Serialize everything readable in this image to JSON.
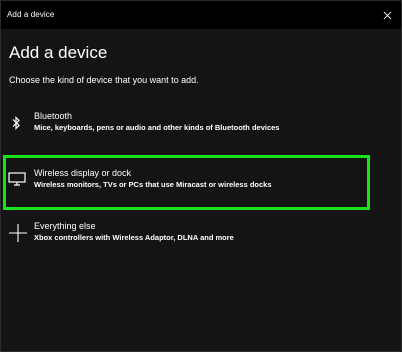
{
  "window": {
    "title": "Add a device"
  },
  "main": {
    "heading": "Add a device",
    "subheading": "Choose the kind of device that you want to add."
  },
  "options": [
    {
      "name": "Bluetooth",
      "description": "Mice, keyboards, pens or audio and other kinds of Bluetooth devices",
      "icon": "bluetooth-icon"
    },
    {
      "name": "Wireless display or dock",
      "description": "Wireless monitors, TVs or PCs that use Miracast or wireless docks",
      "icon": "monitor-icon",
      "highlighted": true,
      "highlight_color": "#19e31c"
    },
    {
      "name": "Everything else",
      "description": "Xbox controllers with Wireless Adaptor, DLNA and more",
      "icon": "plus-icon"
    }
  ],
  "colors": {
    "background": "#141414",
    "titlebar": "#000000",
    "highlight": "#19e31c"
  }
}
